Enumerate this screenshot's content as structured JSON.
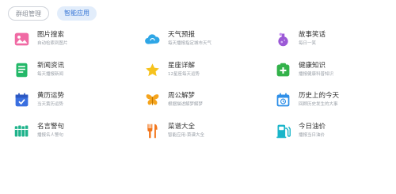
{
  "tabs": [
    {
      "label": "群组管理",
      "active": false
    },
    {
      "label": "智能应用",
      "active": true
    }
  ],
  "colors": {
    "accent": "#3a78d6",
    "tab_active_bg": "#e2edfb"
  },
  "apps": [
    {
      "title": "图片搜索",
      "desc": "自动检索到图片",
      "icon": "image-icon"
    },
    {
      "title": "天气预报",
      "desc": "每天播报指定城市天气",
      "icon": "cloud-icon"
    },
    {
      "title": "故事笑话",
      "desc": "每日一笑",
      "icon": "potion-icon"
    },
    {
      "title": "新闻资讯",
      "desc": "每天播报新闻",
      "icon": "news-icon"
    },
    {
      "title": "星座详解",
      "desc": "12星座每天运势",
      "icon": "star-icon"
    },
    {
      "title": "健康知识",
      "desc": "播报健康科普知识",
      "icon": "health-icon"
    },
    {
      "title": "黄历运势",
      "desc": "当天黄历运势",
      "icon": "calendar-check-icon"
    },
    {
      "title": "周公解梦",
      "desc": "根据描述解梦解梦",
      "icon": "butterfly-icon"
    },
    {
      "title": "历史上的今天",
      "desc": "回顾历史发生的大事",
      "icon": "history-calendar-icon"
    },
    {
      "title": "名言警句",
      "desc": "播报名人警句",
      "icon": "book-icon"
    },
    {
      "title": "菜谱大全",
      "desc": "智能应用-菜谱大全",
      "icon": "utensils-icon"
    },
    {
      "title": "今日油价",
      "desc": "播报当日油价",
      "icon": "fuel-pump-icon"
    }
  ]
}
